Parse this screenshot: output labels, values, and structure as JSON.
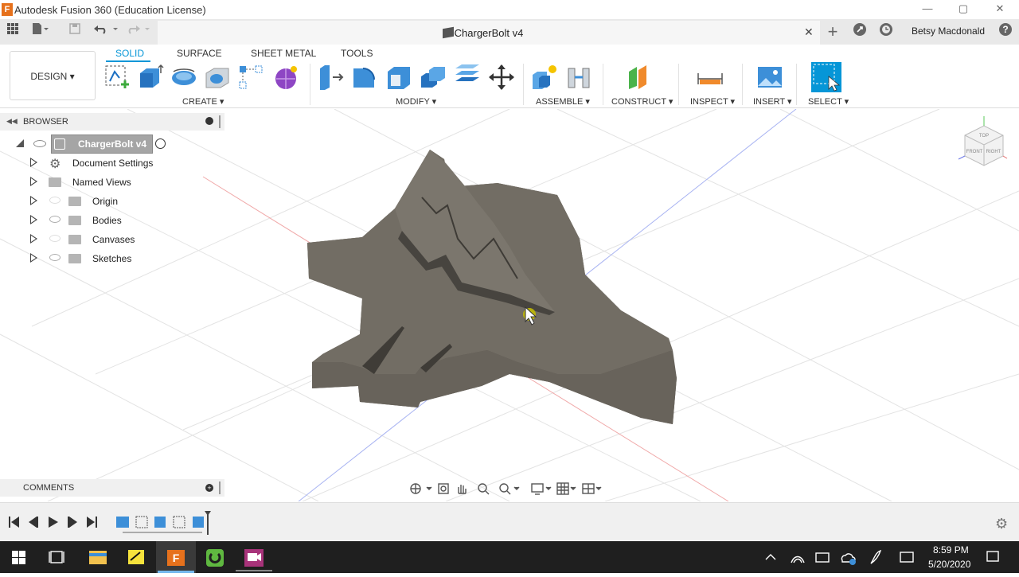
{
  "window": {
    "title": "Autodesk Fusion 360 (Education License)",
    "controls": [
      "minimize-icon",
      "maximize-icon",
      "close-icon"
    ]
  },
  "tabbar": {
    "doc_title": "ChargerBolt v4",
    "user": "Betsy Macdonald",
    "icons": [
      "grid-icon",
      "file-icon",
      "save-icon",
      "undo-icon",
      "redo-icon",
      "close-icon",
      "plus-icon",
      "extensions-icon",
      "clock-icon",
      "help-icon"
    ]
  },
  "toolbar": {
    "workspace": "DESIGN",
    "tabs": [
      "SOLID",
      "SURFACE",
      "SHEET METAL",
      "TOOLS"
    ],
    "active_tab": "SOLID",
    "groups": [
      "CREATE",
      "MODIFY",
      "ASSEMBLE",
      "CONSTRUCT",
      "INSPECT",
      "INSERT",
      "SELECT"
    ]
  },
  "browser": {
    "header": "BROWSER",
    "root": "ChargerBolt v4",
    "items": [
      {
        "label": "Document Settings",
        "icon": "gear-icon"
      },
      {
        "label": "Named Views",
        "icon": "folder-icon"
      },
      {
        "label": "Origin",
        "icon": "folder-icon"
      },
      {
        "label": "Bodies",
        "icon": "folder-icon"
      },
      {
        "label": "Canvases",
        "icon": "folder-icon"
      },
      {
        "label": "Sketches",
        "icon": "folder-icon"
      }
    ]
  },
  "comments": {
    "label": "COMMENTS"
  },
  "viewcube": {
    "top": "TOP",
    "front": "FRONT",
    "right": "RIGHT"
  },
  "taskbar": {
    "time": "8:59 PM",
    "date": "5/20/2020"
  },
  "colors": {
    "accent": "#0696d7",
    "model": "#6f6a62",
    "taskbar": "#1f1f1f"
  }
}
